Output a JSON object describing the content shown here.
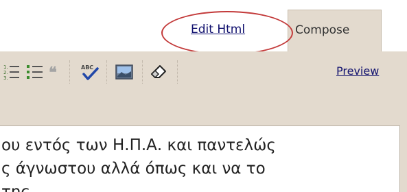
{
  "tabs": {
    "edit_html_label": "Edit Html",
    "compose_label": "Compose"
  },
  "toolbar": {
    "tools": [
      "numbered-list-icon",
      "bulleted-list-icon",
      "blockquote-icon",
      "spellcheck-icon",
      "insert-image-icon",
      "remove-formatting-icon"
    ],
    "blockquote_glyph": "❝❝",
    "spellcheck_text": "ABC",
    "preview_label": "Preview"
  },
  "editor": {
    "lines": [
      "ου εντός των Η.Π.Α. και παντελώς",
      "ς άγνωστου αλλά όπως και να το",
      "της"
    ]
  },
  "colors": {
    "panel": "#e3dace",
    "link": "#10106e",
    "highlight": "#c33a3a"
  }
}
